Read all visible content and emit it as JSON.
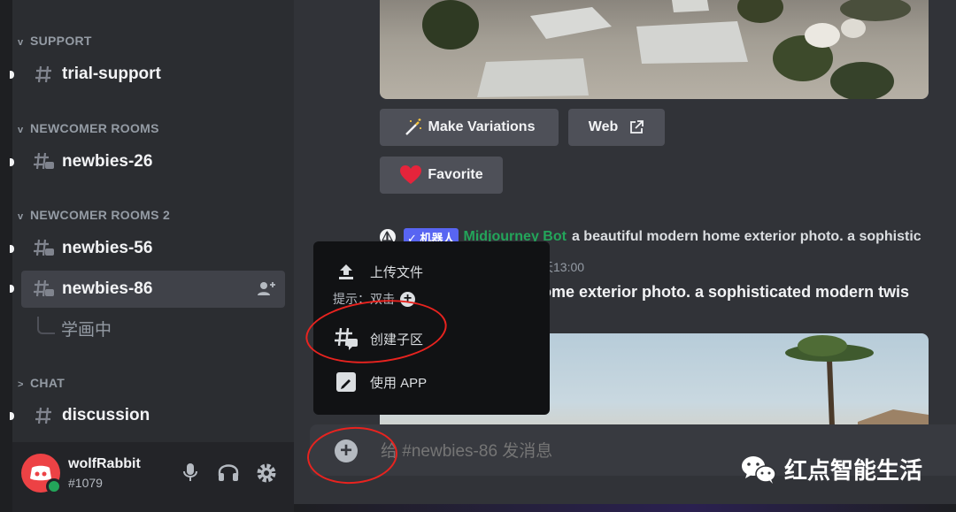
{
  "sidebar": {
    "categories": [
      {
        "label": "SUPPORT",
        "chevron": "v"
      },
      {
        "label": "NEWCOMER ROOMS",
        "chevron": "v"
      },
      {
        "label": "NEWCOMER ROOMS 2",
        "chevron": "v"
      },
      {
        "label": "CHAT",
        "chevron": ">"
      }
    ],
    "channels": [
      {
        "label": "trial-support"
      },
      {
        "label": "newbies-26"
      },
      {
        "label": "newbies-56"
      },
      {
        "label": "newbies-86"
      },
      {
        "label": "discussion"
      }
    ],
    "thread": {
      "label": "学画中"
    }
  },
  "user": {
    "name": "wolfRabbit",
    "tag": "#1079"
  },
  "buttons": {
    "make_variations": "Make Variations",
    "web": "Web",
    "favorite": "Favorite"
  },
  "message": {
    "bot_badge": "✓ 机器人",
    "author": "Midjourney Bot",
    "content_line1": "a beautiful modern home exterior photo. a sophistic",
    "badge2": "人",
    "time": "今天13:00",
    "content_line2": "ome exterior photo. a sophisticated modern twis"
  },
  "popup": {
    "upload": "上传文件",
    "hint": "提示：双击",
    "create_thread": "创建子区",
    "use_app": "使用 APP"
  },
  "composer": {
    "placeholder": "给 #newbies-86 发消息"
  },
  "watermark": {
    "text": "红点智能生活"
  },
  "colors": {
    "accent": "#5865f2",
    "bot_name": "#23a55a",
    "annotation": "#e8231f",
    "favorite_heart": "#e5243b"
  }
}
